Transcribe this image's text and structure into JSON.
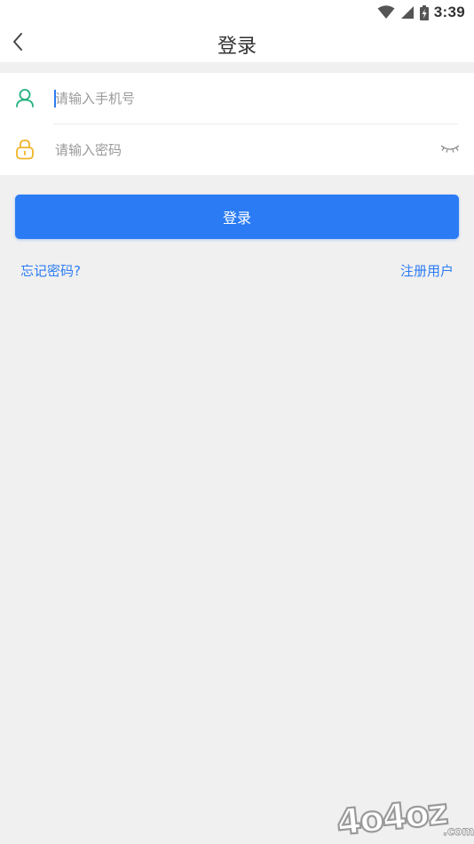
{
  "status_bar": {
    "time": "3:39",
    "icons": [
      "wifi-icon",
      "cellular-signal-icon",
      "battery-charging-icon"
    ]
  },
  "header": {
    "title": "登录",
    "back_icon": "chevron-left-icon"
  },
  "form": {
    "phone": {
      "icon": "user-icon",
      "placeholder": "请输入手机号",
      "value": ""
    },
    "password": {
      "icon": "lock-icon",
      "placeholder": "请输入密码",
      "value": "",
      "toggle_icon": "eye-closed-icon"
    }
  },
  "actions": {
    "login_label": "登录",
    "forgot_label": "忘记密码?",
    "register_label": "注册用户"
  },
  "watermark": {
    "text": "4o4oz",
    "suffix": ".com"
  },
  "colors": {
    "primary": "#2b7cf4",
    "user_icon": "#22b07d",
    "lock_icon": "#f0b429",
    "background": "#f0f0f0"
  }
}
